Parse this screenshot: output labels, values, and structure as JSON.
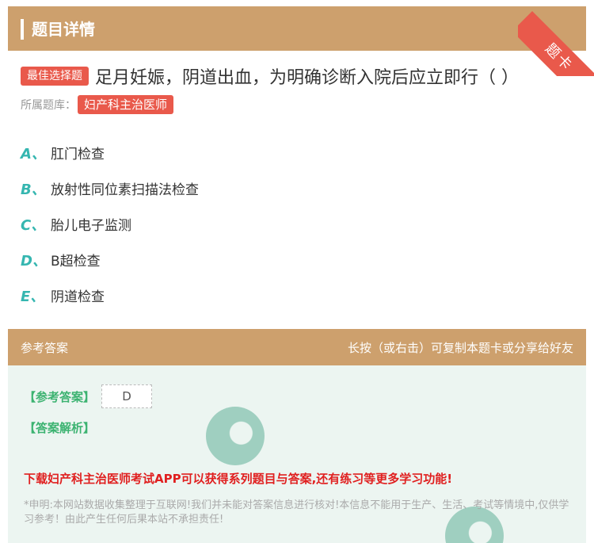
{
  "header": {
    "title": "题目详情",
    "ribbon": "题卡"
  },
  "question": {
    "type_tag": "最佳选择题",
    "text": "足月妊娠，阴道出血，为明确诊断入院后应立即行（ ）",
    "bank_label": "所属题库：",
    "bank_tag": "妇产科主治医师"
  },
  "options": [
    {
      "letter": "A、",
      "text": "肛门检查"
    },
    {
      "letter": "B、",
      "text": "放射性同位素扫描法检查"
    },
    {
      "letter": "C、",
      "text": "胎儿电子监测"
    },
    {
      "letter": "D、",
      "text": "B超检查"
    },
    {
      "letter": "E、",
      "text": "阴道检查"
    }
  ],
  "answer_bar": {
    "left": "参考答案",
    "right": "长按（或右击）可复制本题卡或分享给好友"
  },
  "answer": {
    "label": "【参考答案】",
    "value": "D",
    "analysis_label": "【答案解析】",
    "promo": "下载妇产科主治医师考试APP可以获得系列题目与答案,还有练习等更多学习功能!",
    "disclaimer": "*申明:本网站数据收集整理于互联网!我们并未能对答案信息进行核对!本信息不能用于生产、生活、考试等情境中,仅供学习参考！由此产生任何后果本站不承担责任!"
  },
  "colors": {
    "brand": "#cda06d",
    "accent_red": "#e9594b",
    "option_letter": "#35b6b0",
    "answer_green": "#3cb371"
  }
}
